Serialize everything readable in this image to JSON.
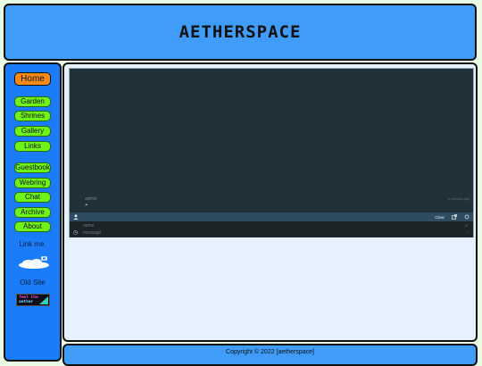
{
  "site": {
    "title": "AETHERSPACE"
  },
  "nav": {
    "home": "Home",
    "primary": [
      "Garden",
      "Shrines",
      "Gallery",
      "Links"
    ],
    "secondary": [
      "Guestbook",
      "Webring",
      "Chat",
      "Archive",
      "About"
    ]
  },
  "sidebar": {
    "link_me": "Link me.",
    "old_site": "Old Site",
    "badge_line1": "feel the",
    "badge_line2": "aether"
  },
  "chat": {
    "message_author": "admin",
    "message_time": "3 months ago",
    "message_flag": "⚑",
    "user_icon": "user-icon",
    "clear_label": "Clear",
    "name_placeholder": "name",
    "message_placeholder": "message"
  },
  "footer": {
    "copyright": "Copyright © 2022 [aetherspace]"
  },
  "colors": {
    "header_bg": "#3f9cf8",
    "sidebar_bg": "#1b7cfa",
    "home_button": "#f78a17",
    "nav_button": "#6ef21a",
    "page_bg": "#e9fbe4",
    "main_bg": "#e7f0ff",
    "chat_bg": "#21313a"
  }
}
